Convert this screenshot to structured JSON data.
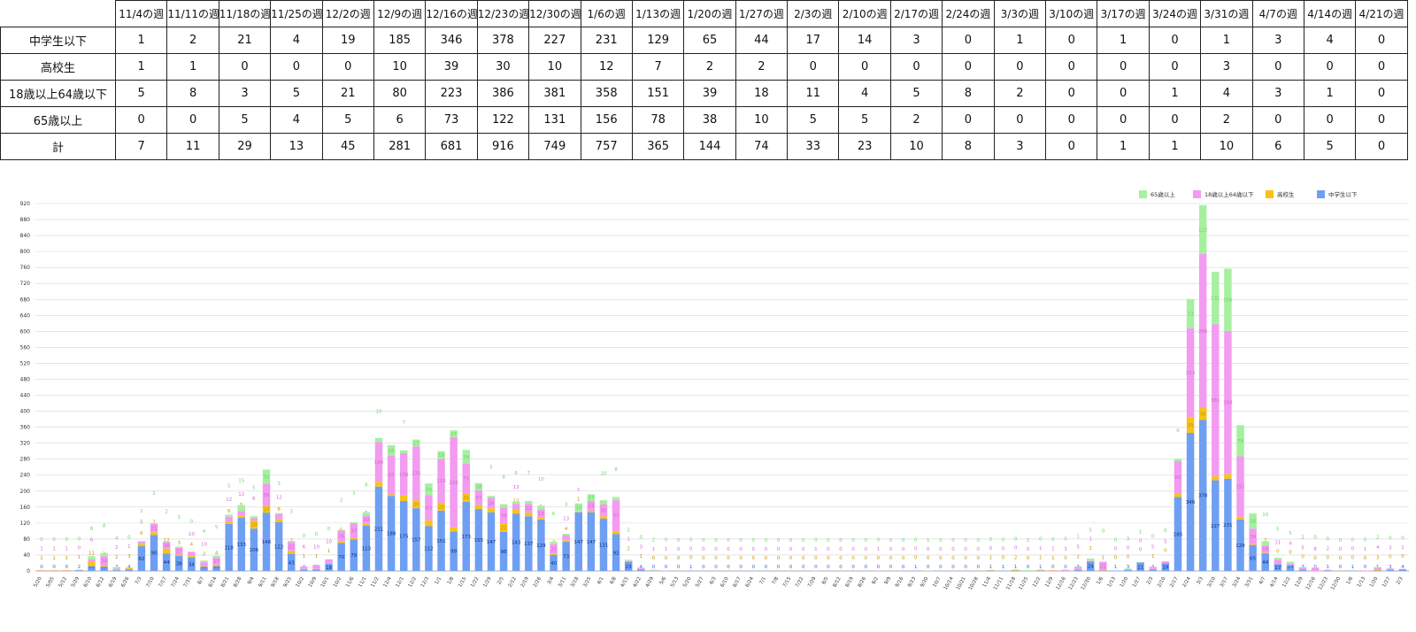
{
  "table": {
    "weeks": [
      "11/4の週",
      "11/11の週",
      "11/18の週",
      "11/25の週",
      "12/2の週",
      "12/9の週",
      "12/16の週",
      "12/23の週",
      "12/30の週",
      "1/6の週",
      "1/13の週",
      "1/20の週",
      "1/27の週",
      "2/3の週",
      "2/10の週",
      "2/17の週",
      "2/24の週",
      "3/3の週",
      "3/10の週",
      "3/17の週",
      "3/24の週",
      "3/31の週",
      "4/7の週",
      "4/14の週",
      "4/21の週"
    ],
    "rows": [
      {
        "label": "中学生以下",
        "values": [
          1,
          2,
          21,
          4,
          19,
          185,
          346,
          378,
          227,
          231,
          129,
          65,
          44,
          17,
          14,
          3,
          0,
          1,
          0,
          1,
          0,
          1,
          3,
          4,
          0
        ]
      },
      {
        "label": "高校生",
        "values": [
          1,
          1,
          0,
          0,
          0,
          10,
          39,
          30,
          10,
          12,
          7,
          2,
          2,
          0,
          0,
          0,
          0,
          0,
          0,
          0,
          0,
          3,
          0,
          0,
          0
        ]
      },
      {
        "label": "18歳以上64歳以下",
        "values": [
          5,
          8,
          3,
          5,
          21,
          80,
          223,
          386,
          381,
          358,
          151,
          39,
          18,
          11,
          4,
          5,
          8,
          2,
          0,
          0,
          1,
          4,
          3,
          1,
          0
        ]
      },
      {
        "label": "65歳以上",
        "values": [
          0,
          0,
          5,
          4,
          5,
          6,
          73,
          122,
          131,
          156,
          78,
          38,
          10,
          5,
          5,
          2,
          0,
          0,
          0,
          0,
          0,
          2,
          0,
          0,
          0
        ]
      },
      {
        "label": "計",
        "values": [
          7,
          11,
          29,
          13,
          45,
          281,
          681,
          916,
          749,
          757,
          365,
          144,
          74,
          33,
          23,
          10,
          8,
          3,
          0,
          1,
          1,
          10,
          6,
          5,
          0
        ]
      }
    ]
  },
  "chart_data": {
    "type": "bar",
    "stacked": true,
    "ylim": [
      0,
      920
    ],
    "yticks": [
      0,
      40,
      80,
      120,
      160,
      200,
      240,
      280,
      320,
      360,
      400,
      440,
      480,
      520,
      560,
      600,
      640,
      680,
      720,
      760,
      800,
      840,
      880,
      920
    ],
    "legend": [
      "65歳以上",
      "18歳以上64歳以下",
      "高校生",
      "中学生以下"
    ],
    "legend_position": "top-right",
    "grid": true,
    "colors": {
      "elem": "#6e9ff2",
      "high": "#f7c21a",
      "adult": "#f29bf0",
      "senior": "#a6f0a0"
    },
    "series": [
      {
        "name": "中学生以下",
        "values": [
          0,
          0,
          0,
          2,
          12,
          10,
          2,
          4,
          62,
          90,
          44,
          38,
          34,
          10,
          12,
          118,
          133,
          106,
          146,
          122,
          43,
          4,
          4,
          18,
          70,
          79,
          113,
          211,
          188,
          175,
          157,
          112,
          151,
          99,
          173,
          155,
          147,
          98,
          143,
          137,
          129,
          40,
          73,
          147,
          147,
          131,
          92,
          23,
          4,
          0,
          0,
          0,
          1,
          0,
          0,
          0,
          0,
          0,
          0,
          0,
          0,
          0,
          0,
          0,
          0,
          0,
          0,
          0,
          0,
          0,
          1,
          0,
          0,
          0,
          0,
          0,
          1,
          1,
          1,
          0,
          1,
          0,
          0,
          3,
          24,
          1,
          1,
          3,
          21,
          4,
          19,
          185,
          346,
          378,
          227,
          231,
          129,
          65,
          44,
          17,
          14,
          3,
          0,
          1,
          0,
          1,
          0,
          1,
          3,
          4
        ]
      },
      {
        "name": "高校生",
        "values": [
          1,
          1,
          1,
          1,
          11,
          3,
          2,
          3,
          6,
          7,
          12,
          3,
          4,
          2,
          4,
          6,
          5,
          20,
          17,
          8,
          7,
          1,
          1,
          1,
          5,
          3,
          6,
          12,
          4,
          14,
          20,
          15,
          20,
          10,
          21,
          10,
          10,
          22,
          12,
          9,
          6,
          2,
          4,
          1,
          4,
          6,
          8,
          2,
          1,
          0,
          0,
          0,
          0,
          0,
          0,
          0,
          0,
          0,
          0,
          0,
          0,
          0,
          0,
          0,
          0,
          0,
          0,
          0,
          0,
          0,
          0,
          0,
          0,
          0,
          0,
          0,
          1,
          0,
          2,
          0,
          1,
          1,
          0,
          2,
          1,
          1,
          0,
          0,
          0,
          1,
          0,
          10,
          39,
          30,
          10,
          12,
          7,
          2,
          2,
          0,
          0,
          0,
          0,
          0,
          0,
          0,
          0,
          3,
          0,
          0
        ]
      },
      {
        "name": "18歳以上64歳以下",
        "values": [
          1,
          1,
          1,
          0,
          6,
          24,
          2,
          1,
          5,
          21,
          16,
          17,
          10,
          10,
          17,
          12,
          12,
          6,
          56,
          12,
          22,
          6,
          10,
          10,
          26,
          37,
          20,
          100,
          97,
          106,
          135,
          63,
          110,
          226,
          75,
          37,
          26,
          39,
          13,
          22,
          18,
          25,
          13,
          1,
          24,
          30,
          77,
          1,
          3,
          1,
          1,
          0,
          0,
          0,
          0,
          0,
          0,
          0,
          0,
          0,
          0,
          0,
          1,
          0,
          0,
          0,
          0,
          1,
          0,
          0,
          0,
          0,
          0,
          0,
          0,
          0,
          0,
          0,
          0,
          0,
          1,
          1,
          3,
          5,
          1,
          21,
          0,
          0,
          0,
          5,
          5,
          80,
          223,
          386,
          381,
          358,
          151,
          39,
          18,
          11,
          4,
          5,
          8,
          2,
          0,
          0,
          1,
          4,
          3,
          1
        ]
      },
      {
        "name": "65歳以上",
        "values": [
          0,
          0,
          0,
          0,
          8,
          8,
          4,
          0,
          2,
          2,
          2,
          3,
          0,
          4,
          5,
          5,
          15,
          5,
          35,
          3,
          3,
          0,
          0,
          0,
          2,
          3,
          8,
          10,
          26,
          7,
          17,
          29,
          19,
          17,
          34,
          18,
          5,
          8,
          6,
          7,
          10,
          6,
          3,
          20,
          17,
          10,
          8,
          2,
          0,
          2,
          0,
          0,
          0,
          0,
          0,
          0,
          0,
          0,
          0,
          0,
          0,
          0,
          0,
          0,
          0,
          0,
          0,
          0,
          0,
          0,
          0,
          1,
          0,
          0,
          0,
          0,
          0,
          0,
          0,
          2,
          0,
          0,
          0,
          1,
          5,
          0,
          0,
          3,
          1,
          0,
          0,
          6,
          73,
          122,
          131,
          156,
          78,
          38,
          10,
          5,
          5,
          2,
          0,
          0,
          0,
          0,
          0,
          2,
          0,
          0
        ]
      }
    ],
    "labels_elem": [
      "0",
      "0",
      "0",
      "2",
      "12",
      "10",
      "2",
      "4",
      "62",
      "90",
      "44",
      "38",
      "34",
      "10",
      "12",
      "118",
      "133",
      "106",
      "146",
      "122",
      "43",
      "4",
      "4",
      "18",
      "70",
      "79",
      "113",
      "211",
      "188",
      "175",
      "157",
      "112",
      "151",
      "99",
      "173",
      "155",
      "147",
      "98",
      "143",
      "137",
      "129",
      "40",
      "73",
      "147",
      "147",
      "131",
      "92",
      "23",
      "4",
      "0",
      "0",
      "0",
      "1",
      "0",
      "0",
      "0",
      "0",
      "0",
      "0",
      "0",
      "0",
      "0",
      "0",
      "0",
      "0",
      "0",
      "0",
      "0",
      "0",
      "0",
      "1",
      "0",
      "0",
      "0",
      "0",
      "0",
      "1",
      "1",
      "1",
      "0",
      "1",
      "0",
      "0",
      "3",
      "24",
      "1",
      "1",
      "3",
      "21",
      "4",
      "19",
      "185",
      "346",
      "378",
      "227",
      "231",
      "129",
      "65",
      "44",
      "17",
      "14",
      "3",
      "0",
      "1",
      "0",
      "1",
      "0",
      "1",
      "3",
      "4"
    ],
    "categories": [
      "5/20",
      "5/05",
      "5/12",
      "5/29",
      "6/10",
      "6/12",
      "6/19",
      "6/26",
      "7/3",
      "7/10",
      "7/17",
      "7/24",
      "7/31",
      "8/7",
      "8/14",
      "8/21",
      "8/28",
      "9/4",
      "9/11",
      "9/18",
      "9/25",
      "10/2",
      "10/9",
      "10/1",
      "10/2",
      "11/6",
      "11/1",
      "11/2",
      "12/4",
      "12/1",
      "12/2",
      "12/3",
      "1/1",
      "1/8",
      "1/15",
      "1/22",
      "1/29",
      "2/5",
      "2/12",
      "2/19",
      "2/26",
      "3/4",
      "3/11",
      "3/18",
      "3/25",
      "4/1",
      "4/8",
      "4/15",
      "4/22",
      "4/29",
      "5/6",
      "5/13",
      "5/20",
      "5/27",
      "6/3",
      "6/10",
      "6/17",
      "6/24",
      "7/1",
      "7/8",
      "7/15",
      "7/22",
      "7/29",
      "8/5",
      "8/12",
      "8/19",
      "8/26",
      "9/2",
      "9/9",
      "9/16",
      "9/23",
      "9/30",
      "10/7",
      "10/14",
      "10/21",
      "10/28",
      "11/4",
      "11/11",
      "11/18",
      "11/25",
      "12/2",
      "12/9",
      "12/16",
      "12/23",
      "12/30",
      "1/6",
      "1/13",
      "1/20",
      "1/27",
      "2/3",
      "2/10",
      "2/17",
      "2/24",
      "3/3",
      "3/10",
      "3/17",
      "3/24",
      "3/31",
      "4/7",
      "4/14",
      "12/2",
      "12/9",
      "12/16",
      "12/23",
      "12/30",
      "1/6",
      "1/13",
      "1/20",
      "1/27",
      "2/3"
    ]
  }
}
